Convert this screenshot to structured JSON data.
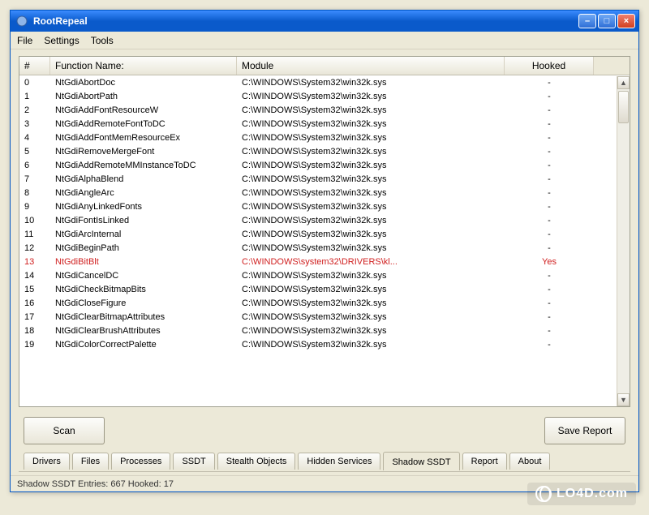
{
  "window": {
    "title": "RootRepeal"
  },
  "menu": {
    "file": "File",
    "settings": "Settings",
    "tools": "Tools"
  },
  "columns": {
    "idx": "#",
    "fn": "Function Name:",
    "mod": "Module",
    "hook": "Hooked"
  },
  "rows": [
    {
      "i": "0",
      "fn": "NtGdiAbortDoc",
      "mod": "C:\\WINDOWS\\System32\\win32k.sys",
      "hook": "-",
      "hooked": false
    },
    {
      "i": "1",
      "fn": "NtGdiAbortPath",
      "mod": "C:\\WINDOWS\\System32\\win32k.sys",
      "hook": "-",
      "hooked": false
    },
    {
      "i": "2",
      "fn": "NtGdiAddFontResourceW",
      "mod": "C:\\WINDOWS\\System32\\win32k.sys",
      "hook": "-",
      "hooked": false
    },
    {
      "i": "3",
      "fn": "NtGdiAddRemoteFontToDC",
      "mod": "C:\\WINDOWS\\System32\\win32k.sys",
      "hook": "-",
      "hooked": false
    },
    {
      "i": "4",
      "fn": "NtGdiAddFontMemResourceEx",
      "mod": "C:\\WINDOWS\\System32\\win32k.sys",
      "hook": "-",
      "hooked": false
    },
    {
      "i": "5",
      "fn": "NtGdiRemoveMergeFont",
      "mod": "C:\\WINDOWS\\System32\\win32k.sys",
      "hook": "-",
      "hooked": false
    },
    {
      "i": "6",
      "fn": "NtGdiAddRemoteMMInstanceToDC",
      "mod": "C:\\WINDOWS\\System32\\win32k.sys",
      "hook": "-",
      "hooked": false
    },
    {
      "i": "7",
      "fn": "NtGdiAlphaBlend",
      "mod": "C:\\WINDOWS\\System32\\win32k.sys",
      "hook": "-",
      "hooked": false
    },
    {
      "i": "8",
      "fn": "NtGdiAngleArc",
      "mod": "C:\\WINDOWS\\System32\\win32k.sys",
      "hook": "-",
      "hooked": false
    },
    {
      "i": "9",
      "fn": "NtGdiAnyLinkedFonts",
      "mod": "C:\\WINDOWS\\System32\\win32k.sys",
      "hook": "-",
      "hooked": false
    },
    {
      "i": "10",
      "fn": "NtGdiFontIsLinked",
      "mod": "C:\\WINDOWS\\System32\\win32k.sys",
      "hook": "-",
      "hooked": false
    },
    {
      "i": "11",
      "fn": "NtGdiArcInternal",
      "mod": "C:\\WINDOWS\\System32\\win32k.sys",
      "hook": "-",
      "hooked": false
    },
    {
      "i": "12",
      "fn": "NtGdiBeginPath",
      "mod": "C:\\WINDOWS\\System32\\win32k.sys",
      "hook": "-",
      "hooked": false
    },
    {
      "i": "13",
      "fn": "NtGdiBitBlt",
      "mod": "C:\\WINDOWS\\system32\\DRIVERS\\kl...",
      "hook": "Yes",
      "hooked": true
    },
    {
      "i": "14",
      "fn": "NtGdiCancelDC",
      "mod": "C:\\WINDOWS\\System32\\win32k.sys",
      "hook": "-",
      "hooked": false
    },
    {
      "i": "15",
      "fn": "NtGdiCheckBitmapBits",
      "mod": "C:\\WINDOWS\\System32\\win32k.sys",
      "hook": "-",
      "hooked": false
    },
    {
      "i": "16",
      "fn": "NtGdiCloseFigure",
      "mod": "C:\\WINDOWS\\System32\\win32k.sys",
      "hook": "-",
      "hooked": false
    },
    {
      "i": "17",
      "fn": "NtGdiClearBitmapAttributes",
      "mod": "C:\\WINDOWS\\System32\\win32k.sys",
      "hook": "-",
      "hooked": false
    },
    {
      "i": "18",
      "fn": "NtGdiClearBrushAttributes",
      "mod": "C:\\WINDOWS\\System32\\win32k.sys",
      "hook": "-",
      "hooked": false
    },
    {
      "i": "19",
      "fn": "NtGdiColorCorrectPalette",
      "mod": "C:\\WINDOWS\\System32\\win32k.sys",
      "hook": "-",
      "hooked": false
    }
  ],
  "buttons": {
    "scan": "Scan",
    "save": "Save Report"
  },
  "tabs": {
    "drivers": "Drivers",
    "files": "Files",
    "processes": "Processes",
    "ssdt": "SSDT",
    "stealth": "Stealth Objects",
    "hidden": "Hidden Services",
    "shadow": "Shadow SSDT",
    "report": "Report",
    "about": "About"
  },
  "status": {
    "text": "Shadow SSDT Entries: 667   Hooked: 17"
  },
  "watermark": {
    "text": "LO4D.com"
  }
}
